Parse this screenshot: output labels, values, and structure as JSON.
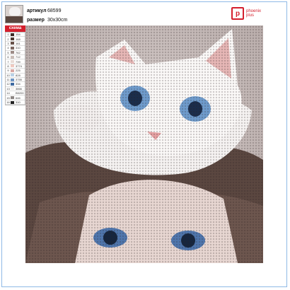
{
  "header": {
    "article_label": "артикул",
    "article_value": "68599",
    "size_label": "размер",
    "size_value": "30x30cm"
  },
  "logo": {
    "mark": "p",
    "line1": "phoenix",
    "line2": "plus"
  },
  "schema": {
    "title": "схема",
    "rows": [
      {
        "n": "1",
        "code": "154",
        "color": "#3b2a25"
      },
      {
        "n": "2",
        "code": "168",
        "color": "#4e3a33"
      },
      {
        "n": "3",
        "code": "161",
        "color": "#675048"
      },
      {
        "n": "4",
        "code": "310",
        "color": "#7d6760"
      },
      {
        "n": "5",
        "code": "762",
        "color": "#9c8b86"
      },
      {
        "n": "6",
        "code": "712",
        "color": "#c9bcb7"
      },
      {
        "n": "7",
        "code": "739",
        "color": "#e8dcd7"
      },
      {
        "n": "8",
        "code": "3774",
        "color": "#efc9bf"
      },
      {
        "n": "9",
        "code": "225",
        "color": "#d8a7a3"
      },
      {
        "n": "10",
        "code": "828",
        "color": "#b9d1e6"
      },
      {
        "n": "11",
        "code": "3755",
        "color": "#6e95c3"
      },
      {
        "n": "12",
        "code": "334",
        "color": "#3f6aa1"
      },
      {
        "n": "13",
        "code": "3866",
        "color": "#f4f1ef"
      },
      {
        "n": "14",
        "code": "B5200",
        "color": "#ffffff"
      },
      {
        "n": "15",
        "code": "646",
        "color": "#8c8582"
      },
      {
        "n": "16",
        "code": "310",
        "color": "#222222"
      }
    ]
  }
}
